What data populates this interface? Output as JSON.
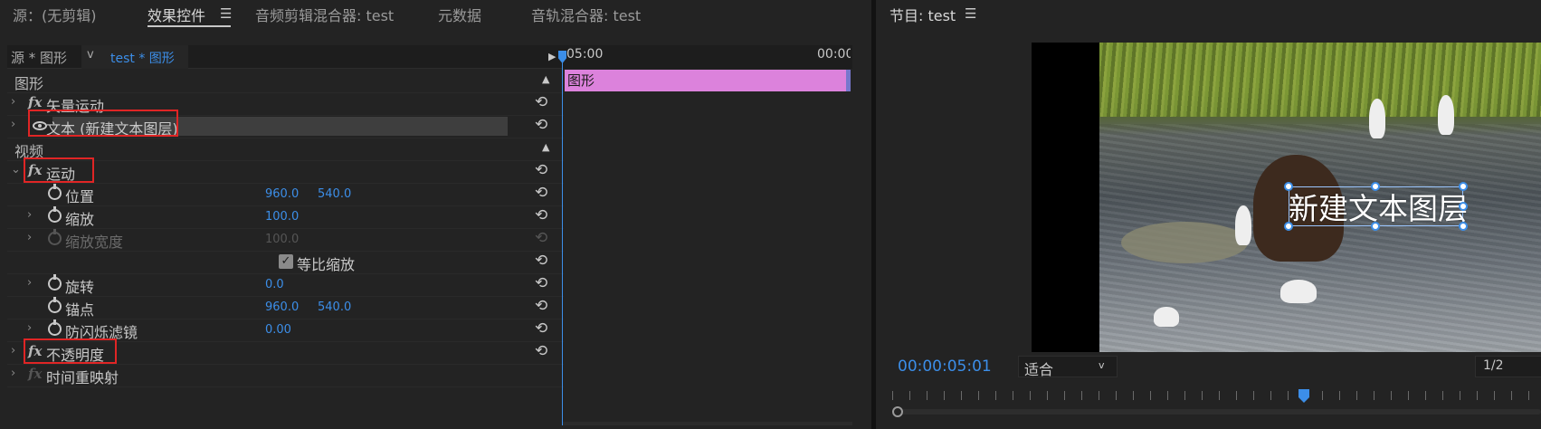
{
  "left_tabs": [
    {
      "label": "源：(无剪辑)"
    },
    {
      "label": "效果控件"
    },
    {
      "label": "音频剪辑混合器: test"
    },
    {
      "label": "元数据"
    },
    {
      "label": "音轨混合器: test"
    }
  ],
  "effect_controls": {
    "source_label": "源 * 图形",
    "clip_label": "test * 图形",
    "sections": {
      "graphic": "图形",
      "video": "视频"
    },
    "rows": {
      "vector_motion": "矢量运动",
      "text_layer": "文本 (新建文本图层)",
      "motion": "运动",
      "position": {
        "label": "位置",
        "x": "960.0",
        "y": "540.0"
      },
      "scale": {
        "label": "缩放",
        "value": "100.0"
      },
      "scale_width": {
        "label": "缩放宽度",
        "value": "100.0"
      },
      "uniform_scale": {
        "label": "等比缩放",
        "checked": true
      },
      "rotation": {
        "label": "旋转",
        "value": "0.0"
      },
      "anchor": {
        "label": "锚点",
        "x": "960.0",
        "y": "540.0"
      },
      "anti_flicker": {
        "label": "防闪烁滤镜",
        "value": "0.00"
      },
      "opacity": "不透明度",
      "time_remap": "时间重映射"
    }
  },
  "timeline": {
    "start_time": "05:00",
    "end_time": "00:00:",
    "clip_label": "图形"
  },
  "program_monitor": {
    "title": "节目: test",
    "overlay_text": "新建文本图层",
    "timecode": "00:00:05:01",
    "fit": "适合",
    "resolution": "1/2"
  },
  "colors": {
    "accent_blue": "#3c8ee8",
    "clip_pink": "#dc82dc",
    "highlight_red": "#e02525"
  }
}
